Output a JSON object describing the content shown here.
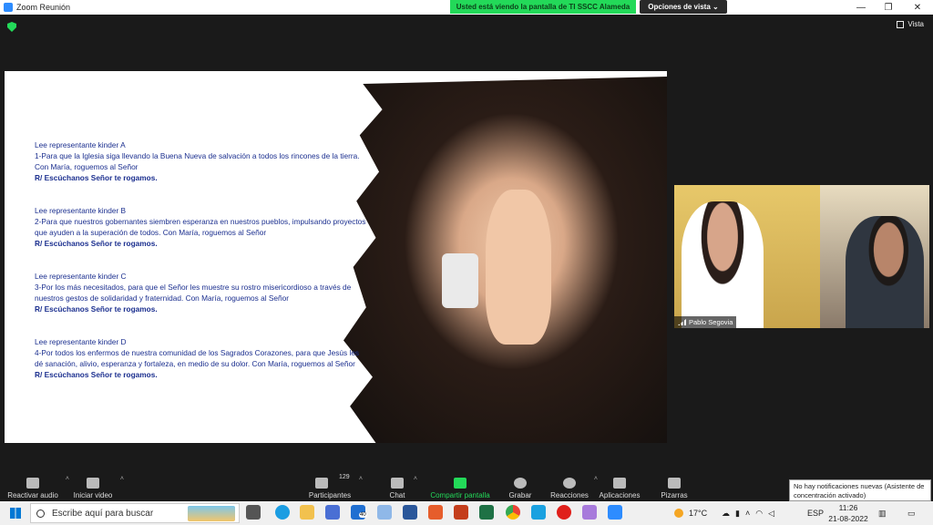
{
  "window": {
    "title": "Zoom Reunión",
    "sharing_banner": "Usted está viendo la pantalla de TI SSCC Alameda",
    "view_options": "Opciones de vista",
    "view_label": "Vista"
  },
  "slide": {
    "blocks": [
      {
        "head": "Lee representante kinder A",
        "body": "1-Para que la Iglesia siga llevando la Buena Nueva de salvación a todos los rincones de la tierra. Con María, roguemos al Señor",
        "response": "R/ Escúchanos Señor te rogamos."
      },
      {
        "head": "Lee representante kinder B",
        "body": "2-Para que nuestros gobernantes siembren esperanza en nuestros pueblos, impulsando proyectos que ayuden a la superación de todos. Con María, roguemos al Señor",
        "response": "R/ Escúchanos Señor te rogamos."
      },
      {
        "head": "Lee representante kinder C",
        "body": "3-Por los más necesitados, para que el Señor les muestre su rostro misericordioso a través de nuestros gestos de solidaridad y fraternidad. Con María, roguemos al Señor",
        "response": "R/ Escúchanos Señor te rogamos."
      },
      {
        "head": "Lee representante kinder D",
        "body": "4-Por todos los enfermos de nuestra comunidad de los Sagrados Corazones, para que Jesús les dé sanación, alivio, esperanza y fortaleza, en medio de su dolor. Con María, roguemos al Señor",
        "response": "R/ Escúchanos Señor te rogamos."
      }
    ]
  },
  "video_tile": {
    "participant_name": "Pablo Segovia"
  },
  "toolbar": {
    "unmute": "Reactivar audio",
    "start_video": "Iniciar video",
    "participants": "Participantes",
    "participants_count": "129",
    "chat": "Chat",
    "share_screen": "Compartir pantalla",
    "record": "Grabar",
    "reactions": "Reacciones",
    "apps": "Aplicaciones",
    "whiteboards": "Pizarras"
  },
  "tooltip": "No hay notificaciones nuevas (Asistente de concentración activado)",
  "taskbar": {
    "search_placeholder": "Escribe aquí para buscar",
    "mail_badge": "40",
    "temperature": "17°C",
    "language": "ESP",
    "time": "11:26",
    "date": "21-08-2022"
  },
  "colors": {
    "share_green": "#23d959",
    "slide_text": "#1b2f8f",
    "zoom_blue": "#2d8cff"
  }
}
